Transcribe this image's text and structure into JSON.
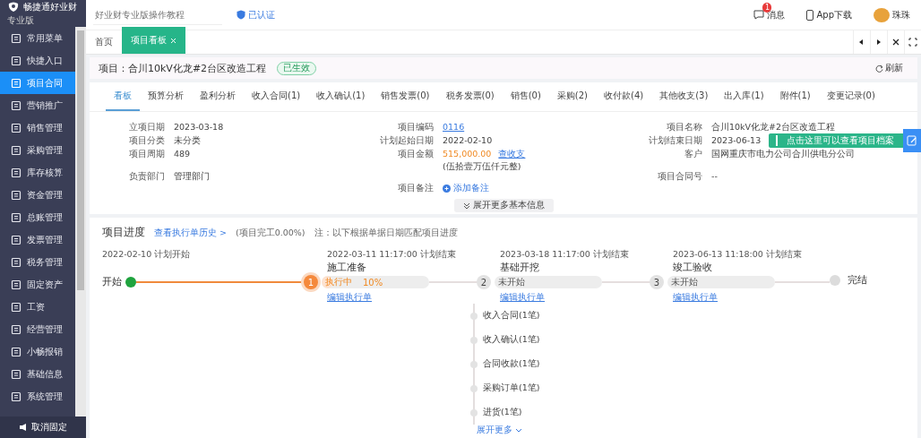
{
  "logo": {
    "name": "畅捷通好业财",
    "edition": "专业版"
  },
  "search": {
    "placeholder": "好业财专业版操作教程"
  },
  "verified": "已认证",
  "header_actions": [
    {
      "kind": "message",
      "label": "消息",
      "badge": "1"
    },
    {
      "kind": "app",
      "label": "App下载"
    },
    {
      "kind": "user",
      "label": "珠珠"
    }
  ],
  "sidebar": {
    "items": [
      {
        "label": "常用菜单",
        "selected": false
      },
      {
        "label": "快捷入口",
        "selected": false
      },
      {
        "label": "项目合同",
        "selected": true
      },
      {
        "label": "营销推广",
        "selected": false
      },
      {
        "label": "销售管理",
        "selected": false
      },
      {
        "label": "采购管理",
        "selected": false
      },
      {
        "label": "库存核算",
        "selected": false
      },
      {
        "label": "资金管理",
        "selected": false
      },
      {
        "label": "总账管理",
        "selected": false
      },
      {
        "label": "发票管理",
        "selected": false
      },
      {
        "label": "税务管理",
        "selected": false
      },
      {
        "label": "固定资产",
        "selected": false
      },
      {
        "label": "工资",
        "selected": false
      },
      {
        "label": "经营管理",
        "selected": false
      },
      {
        "label": "小畅报销",
        "selected": false
      },
      {
        "label": "基础信息",
        "selected": false
      },
      {
        "label": "系统管理",
        "selected": false
      }
    ],
    "footer": "取消固定"
  },
  "page_tabs": [
    {
      "label": "首页",
      "selected": false,
      "closable": false
    },
    {
      "label": "项目看板",
      "selected": true,
      "closable": true
    }
  ],
  "project": {
    "title": "项目：合川10kV化龙#2台区改造工程",
    "status": "已生效",
    "refresh": "刷新"
  },
  "sub_tabs": [
    {
      "label": "看板",
      "selected": true
    },
    {
      "label": "预算分析",
      "selected": false
    },
    {
      "label": "盈利分析",
      "selected": false
    },
    {
      "label": "收入合同(1)",
      "selected": false
    },
    {
      "label": "收入确认(1)",
      "selected": false
    },
    {
      "label": "销售发票(0)",
      "selected": false
    },
    {
      "label": "税务发票(0)",
      "selected": false
    },
    {
      "label": "销售(0)",
      "selected": false
    },
    {
      "label": "采购(2)",
      "selected": false
    },
    {
      "label": "收付款(4)",
      "selected": false
    },
    {
      "label": "其他收支(3)",
      "selected": false
    },
    {
      "label": "出入库(1)",
      "selected": false
    },
    {
      "label": "附件(1)",
      "selected": false
    },
    {
      "label": "变更记录(0)",
      "selected": false
    }
  ],
  "info": {
    "columns": [
      [
        {
          "kind": "text",
          "label": "立项日期",
          "value": "2023-03-18"
        },
        {
          "kind": "text",
          "label": "项目分类",
          "value": "未分类"
        },
        {
          "kind": "text",
          "label": "项目周期",
          "value": "489"
        },
        {
          "kind": "text",
          "label": "负责部门",
          "value": "管理部门"
        }
      ],
      [
        {
          "kind": "link",
          "label": "项目编码",
          "value": "0116"
        },
        {
          "kind": "text",
          "label": "计划起始日期",
          "value": "2022-02-10"
        },
        {
          "kind": "amount",
          "label": "项目金额",
          "value": "515,000.00",
          "link": "查收支",
          "note": "(伍拾壹万伍仟元整)"
        },
        {
          "kind": "add",
          "label": "项目备注",
          "value": "添加备注"
        }
      ],
      [
        {
          "kind": "text",
          "label": "项目名称",
          "value": "合川10kV化龙#2台区改造工程"
        },
        {
          "kind": "text",
          "label": "计划结束日期",
          "value": "2023-06-13"
        },
        {
          "kind": "text",
          "label": "客户",
          "value": "国网重庆市电力公司合川供电分公司"
        },
        {
          "kind": "text",
          "label": "项目合同号",
          "value": "--"
        }
      ]
    ],
    "expand": "展开更多基本信息"
  },
  "tooltip": {
    "text": "点击这里可以查看项目档案"
  },
  "progress": {
    "title": "项目进度",
    "history_link": "查看执行单历史 >",
    "completion": "(项目完工0.00%)",
    "note": "注：以下根据单据日期匹配项目进度",
    "start": {
      "date": "2022-02-10 计划开始",
      "label": "开始"
    },
    "stages": [
      {
        "number": "1",
        "date": "2022-03-11 11:17:00 计划结束",
        "title": "施工准备",
        "kind": "in_progress",
        "status_text": "执行中",
        "percent": "10%",
        "level": 0.1,
        "link": "编辑执行单"
      },
      {
        "number": "2",
        "date": "2023-03-18 11:17:00 计划结束",
        "title": "基础开挖",
        "kind": "not_started",
        "status_text": "未开始",
        "level": 0,
        "link": "编辑执行单",
        "documents": [
          "收入合同(1笔)",
          "收入确认(1笔)",
          "合同收款(1笔)",
          "采购订单(1笔)",
          "进货(1笔)"
        ],
        "more": "展开更多"
      },
      {
        "number": "3",
        "date": "2023-06-13 11:18:00 计划结束",
        "title": "竣工验收",
        "kind": "not_started",
        "status_text": "未开始",
        "level": 0,
        "link": "编辑执行单"
      }
    ],
    "end": {
      "label": "完结"
    }
  }
}
